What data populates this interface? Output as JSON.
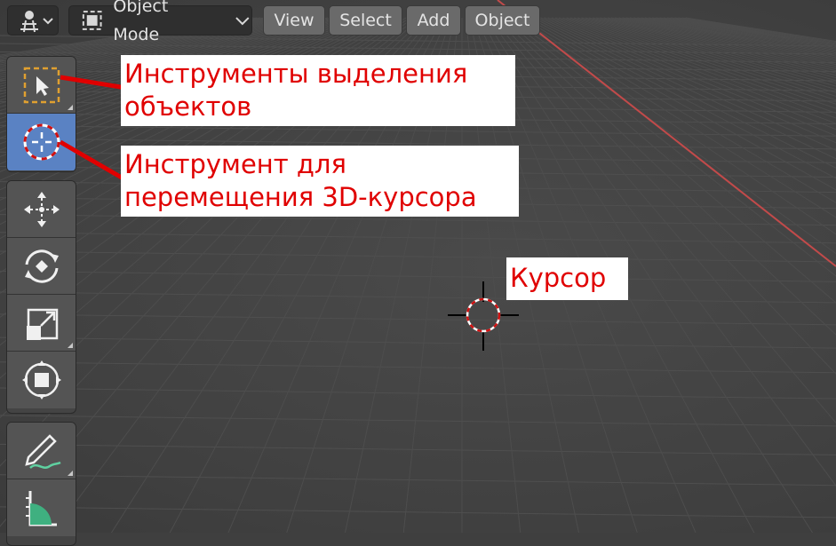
{
  "header": {
    "mode": "Object Mode",
    "menus": [
      {
        "label": "View"
      },
      {
        "label": "Select"
      },
      {
        "label": "Add"
      },
      {
        "label": "Object"
      }
    ]
  },
  "toolbar": {
    "tools": [
      {
        "name": "select-box",
        "icon": "select-box-icon",
        "active": false
      },
      {
        "name": "cursor",
        "icon": "cursor-3d-icon",
        "active": true
      },
      {
        "name": "move",
        "icon": "move-icon",
        "active": false
      },
      {
        "name": "rotate",
        "icon": "rotate-icon",
        "active": false
      },
      {
        "name": "scale",
        "icon": "scale-icon",
        "active": false
      },
      {
        "name": "transform",
        "icon": "transform-icon",
        "active": false
      },
      {
        "name": "annotate",
        "icon": "annotate-icon",
        "active": false
      },
      {
        "name": "measure",
        "icon": "measure-icon",
        "active": false
      }
    ]
  },
  "annotations": {
    "selection_tools_line1": "Инструменты выделения",
    "selection_tools_line2": "объектов",
    "cursor_tool_line1": "Инструмент для",
    "cursor_tool_line2": "перемещения 3D-курсора",
    "cursor_label": "Курсор"
  },
  "colors": {
    "active_tool": "#5a82c3",
    "annotation_text": "#e00000",
    "x_axis": "#c24a4a",
    "viewport_bg": "#404040"
  }
}
